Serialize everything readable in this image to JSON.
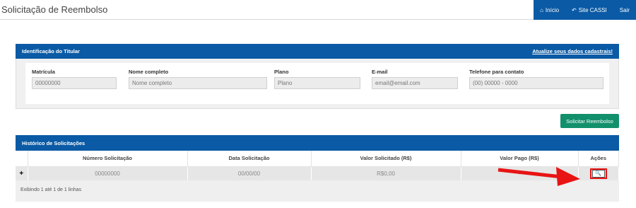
{
  "header": {
    "title": "Solicitação de Reembolso",
    "nav": [
      {
        "icon": "home-icon",
        "label": "Início"
      },
      {
        "icon": "back-arrow-icon",
        "label": "Site CASSI"
      },
      {
        "label": "Sair"
      }
    ]
  },
  "titular": {
    "heading": "Identificação do Titular",
    "update_link": "Atualize seus dados cadastrais!",
    "fields": [
      {
        "label": "Matrícula",
        "value": "00000000"
      },
      {
        "label": "Nome completo",
        "value": "Nome completo"
      },
      {
        "label": "Plano",
        "value": "Plano"
      },
      {
        "label": "E-mail",
        "value": "email@email.com"
      },
      {
        "label": "Telefone para contato",
        "value": "(00) 00000 - 0000"
      }
    ]
  },
  "actions": {
    "request_button": "Solicitar Reembolso"
  },
  "historico": {
    "heading": "Histórico de Solicitações",
    "columns": [
      "Número Solicitação",
      "Data Solicitação",
      "Valor Solicitado (R$)",
      "Valor Pago (R$)",
      "Ações"
    ],
    "rows": [
      {
        "expand": "+",
        "numero": "00000000",
        "data": "00/00/00",
        "valor_solicitado": "R$0,00",
        "valor_pago": "-"
      }
    ],
    "footer": "Exibindo 1 até 1 de 1 linhas"
  },
  "colors": {
    "primary": "#0a5aa5",
    "success": "#12906c",
    "annotation": "#e81414"
  }
}
